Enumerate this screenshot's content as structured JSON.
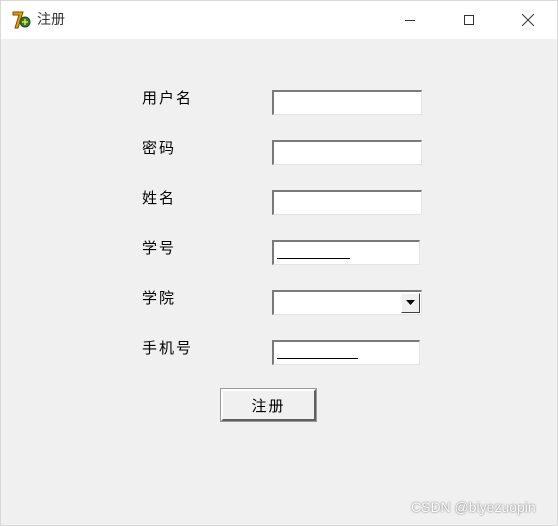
{
  "window": {
    "title": "注册",
    "icon": "app-logo-icon",
    "controls": [
      "minimize-icon",
      "maximize-icon",
      "close-icon"
    ]
  },
  "form": {
    "username_label": "用户名",
    "username_value": "",
    "password_label": "密码",
    "password_value": "",
    "name_label": "姓名",
    "name_value": "",
    "student_id_label": "学号",
    "student_id_value": "",
    "college_label": "学院",
    "college_value": "",
    "phone_label": "手机号",
    "phone_value": "",
    "submit_label": "注册"
  },
  "watermark": "CSDN @biyezuopin",
  "colors": {
    "window_bg": "#f0f0f0",
    "titlebar_bg": "#ffffff",
    "field_bg": "#ffffff"
  }
}
